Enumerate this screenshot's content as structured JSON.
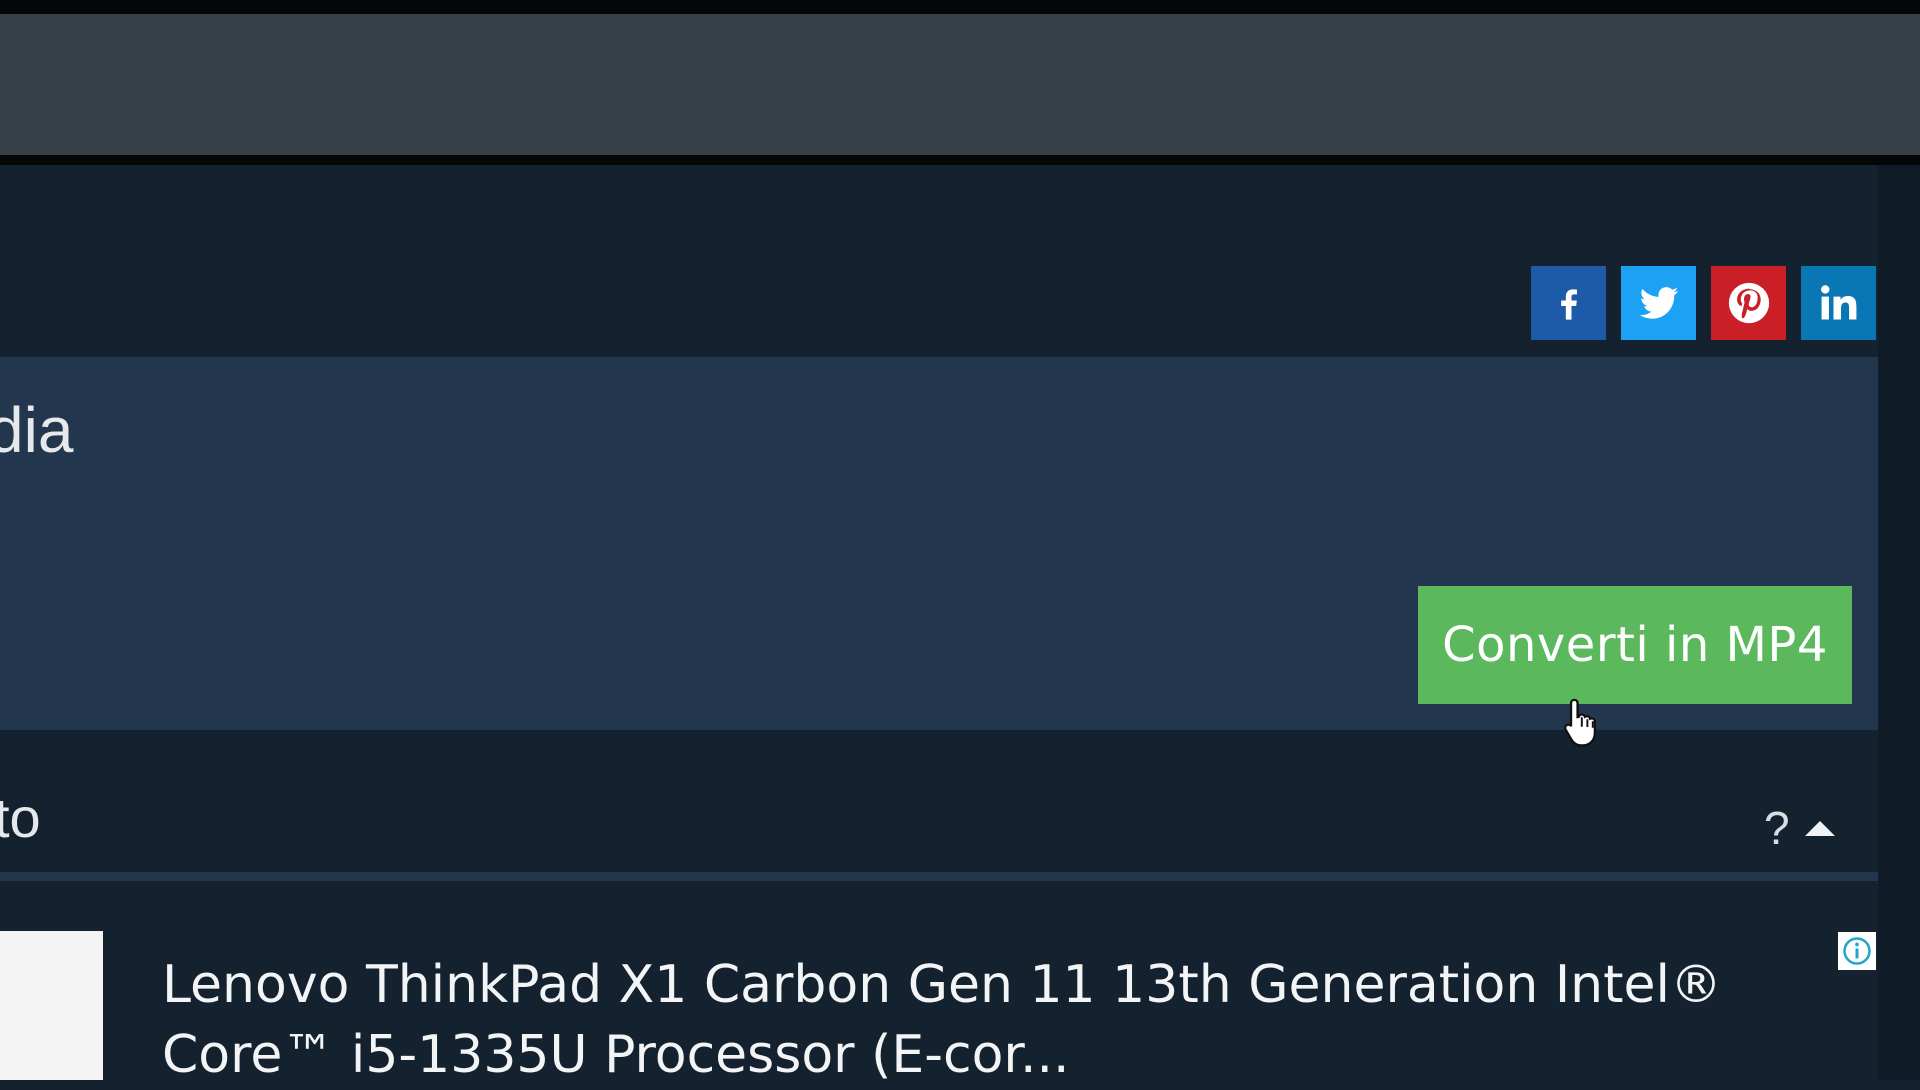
{
  "window": {
    "topbar_color": "#373f48"
  },
  "share": {
    "items": [
      {
        "network": "facebook",
        "icon": "facebook-icon",
        "color": "#1d5aa7"
      },
      {
        "network": "twitter",
        "icon": "twitter-icon",
        "color": "#1da1f2"
      },
      {
        "network": "pinterest",
        "icon": "pinterest-icon",
        "color": "#cb1f27"
      },
      {
        "network": "linkedin",
        "icon": "linkedin-icon",
        "color": "#0a77b5"
      }
    ]
  },
  "converter": {
    "title_fragment": "dia",
    "convert_button_label": "Converti in MP4",
    "button_color": "#5cb85c",
    "panel_color": "#22364e"
  },
  "section": {
    "title_fragment": "to",
    "help_label": "?",
    "collapse_icon": "caret-up-icon"
  },
  "ad": {
    "title": "Lenovo ThinkPad X1 Carbon Gen 11 13th Generation Intel® Core™ i5-1335U Processor (E-cor...",
    "info_icon": "ad-info-icon"
  }
}
